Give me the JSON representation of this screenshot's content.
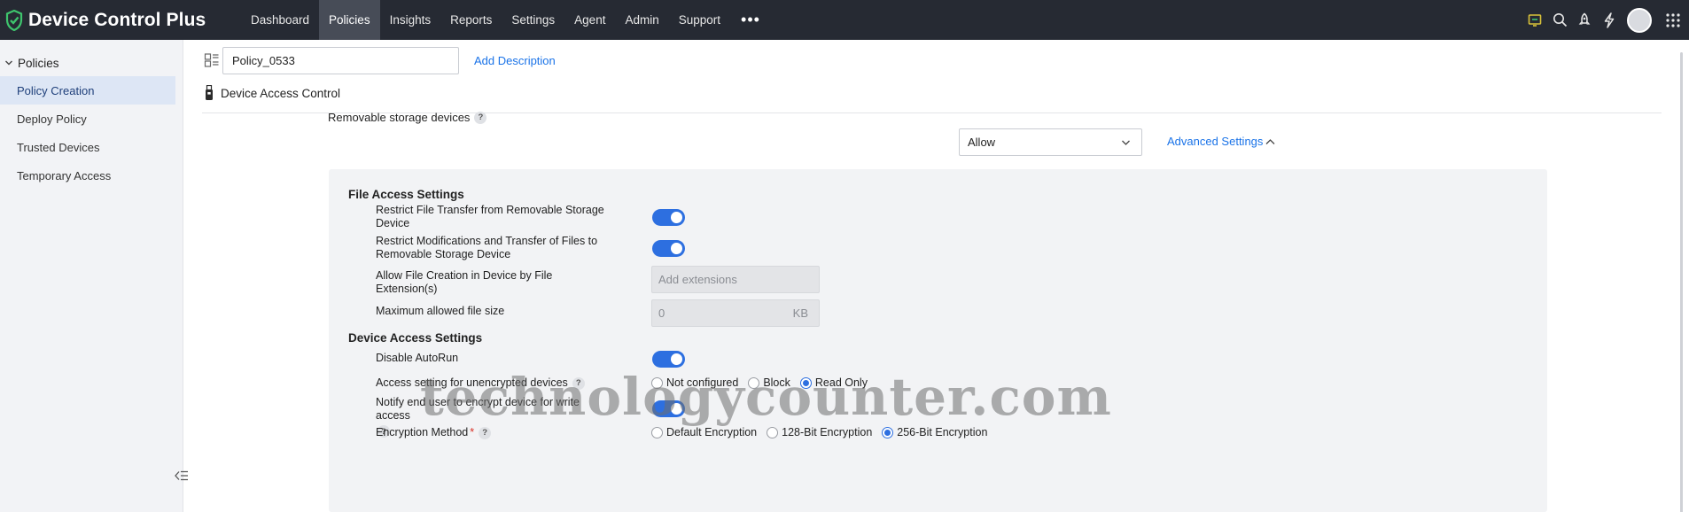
{
  "app": {
    "title": "Device Control Plus"
  },
  "nav": {
    "items": [
      {
        "label": "Dashboard",
        "active": false
      },
      {
        "label": "Policies",
        "active": true
      },
      {
        "label": "Insights",
        "active": false
      },
      {
        "label": "Reports",
        "active": false
      },
      {
        "label": "Settings",
        "active": false
      },
      {
        "label": "Agent",
        "active": false
      },
      {
        "label": "Admin",
        "active": false
      },
      {
        "label": "Support",
        "active": false
      }
    ],
    "more_label": "•••"
  },
  "top_icons": [
    "remote-icon",
    "search-icon",
    "rocket-icon",
    "bolt-icon",
    "avatar",
    "apps-grid-icon"
  ],
  "sidebar": {
    "group_label": "Policies",
    "items": [
      {
        "label": "Policy Creation",
        "active": true
      },
      {
        "label": "Deploy Policy",
        "active": false
      },
      {
        "label": "Trusted Devices",
        "active": false
      },
      {
        "label": "Temporary Access",
        "active": false
      }
    ]
  },
  "policy": {
    "name_value": "Policy_0533",
    "add_description": "Add Description",
    "section_title": "Device Access Control"
  },
  "removable": {
    "label": "Removable storage devices",
    "help": "?",
    "select_value": "Allow",
    "advanced_settings": "Advanced Settings"
  },
  "file_access": {
    "title": "File Access Settings",
    "restrict_transfer_label": "Restrict File Transfer from Removable Storage Device",
    "restrict_transfer_on": true,
    "restrict_modifications_label": "Restrict Modifications and Transfer of Files to Removable Storage Device",
    "restrict_modifications_on": true,
    "allow_creation_label": "Allow File Creation in Device by File Extension(s)",
    "extensions_placeholder": "Add extensions",
    "max_size_label": "Maximum allowed file size",
    "max_size_value": "0",
    "max_size_unit": "KB"
  },
  "device_access": {
    "title": "Device Access Settings",
    "disable_autorun_label": "Disable AutoRun",
    "disable_autorun_on": true,
    "unencrypted_label": "Access setting for unencrypted devices",
    "unencrypted_options": [
      {
        "label": "Not configured",
        "checked": false
      },
      {
        "label": "Block",
        "checked": false
      },
      {
        "label": "Read Only",
        "checked": true
      }
    ],
    "notify_label": "Notify end user to encrypt device for write access",
    "notify_on": true,
    "encryption_label": "Encryption Method",
    "required_mark": "*",
    "encryption_options": [
      {
        "label": "Default Encryption",
        "checked": false
      },
      {
        "label": "128-Bit Encryption",
        "checked": false
      },
      {
        "label": "256-Bit Encryption",
        "checked": true
      }
    ]
  },
  "watermark": "technologycounter.com",
  "colors": {
    "topbar": "#262a33",
    "accent": "#2d6fe0",
    "link": "#1a73e8",
    "active_nav": "#474c57"
  }
}
